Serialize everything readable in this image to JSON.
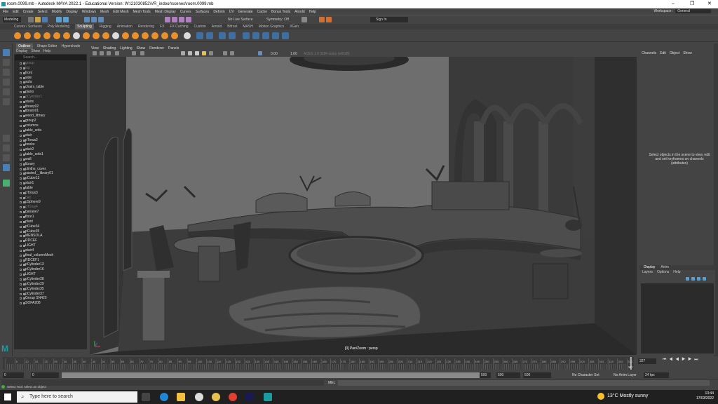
{
  "title": "room.0099.mb - Autodesk MAYA 2022.1 - Educational Version: W:\\21030852\\VR_indoor\\scenes\\room.0099.mb",
  "menu": [
    "File",
    "Edit",
    "Create",
    "Select",
    "Modify",
    "Display",
    "Windows",
    "Mesh",
    "Edit Mesh",
    "Mesh Tools",
    "Mesh Display",
    "Curves",
    "Surfaces",
    "Deform",
    "UV",
    "Generate",
    "Cache",
    "Bonus Tools",
    "Arnold",
    "Help"
  ],
  "workspace": {
    "label": "Workspace :",
    "value": "General"
  },
  "status": {
    "mode": "Modeling",
    "live": "No Live Surface",
    "symmetry": "Symmetry: Off",
    "signin": "Sign In"
  },
  "shelf_tabs": [
    "Curves / Surfaces",
    "Poly Modeling",
    "Sculpting",
    "Rigging",
    "Animation",
    "Rendering",
    "FX",
    "FX Caching",
    "Custom",
    "Arnold",
    "Bifrost",
    "MASH",
    "Motion Graphics",
    "XGen"
  ],
  "shelf_active": "Sculpting",
  "outliner": {
    "tabs": [
      "Outliner",
      "Shape Editor",
      "Hypershade"
    ],
    "menu": [
      "Display",
      "Show",
      "Help"
    ],
    "search": "Search...",
    "items": [
      {
        "n": "group",
        "d": true
      },
      {
        "n": "top",
        "d": true
      },
      {
        "n": "front",
        "d": false
      },
      {
        "n": "side",
        "d": false
      },
      {
        "n": "sofa",
        "d": false
      },
      {
        "n": "chairs_table",
        "d": false
      },
      {
        "n": "piano",
        "d": false
      },
      {
        "n": "pCylinder1",
        "d": true
      },
      {
        "n": "stairs",
        "d": false
      },
      {
        "n": "library02",
        "d": false
      },
      {
        "n": "library01",
        "d": false
      },
      {
        "n": "wood_library",
        "d": false
      },
      {
        "n": "group2",
        "d": false
      },
      {
        "n": "columns",
        "d": false
      },
      {
        "n": "table_sofa",
        "d": false
      },
      {
        "n": "stair",
        "d": false
      },
      {
        "n": "pTorus2",
        "d": false
      },
      {
        "n": "books",
        "d": false
      },
      {
        "n": "stair2",
        "d": false
      },
      {
        "n": "table_sofa1",
        "d": false
      },
      {
        "n": "wall",
        "d": false
      },
      {
        "n": "library",
        "d": false
      },
      {
        "n": "plinths_cover",
        "d": false
      },
      {
        "n": "pasted__library01",
        "d": false
      },
      {
        "n": "pCube13",
        "d": false
      },
      {
        "n": "stair1",
        "d": false
      },
      {
        "n": "table",
        "d": false
      },
      {
        "n": "pTorus3",
        "d": false
      },
      {
        "n": "ball",
        "d": true
      },
      {
        "n": "pSphere9",
        "d": false
      },
      {
        "n": "pTorus4",
        "d": true
      },
      {
        "n": "banane7",
        "d": false
      },
      {
        "n": "floor1",
        "d": false
      },
      {
        "n": "plant",
        "d": false
      },
      {
        "n": "pCube34",
        "d": false
      },
      {
        "n": "pCube35",
        "d": false
      },
      {
        "n": "MENSOLA",
        "d": false
      },
      {
        "n": "RDCEF",
        "d": false
      },
      {
        "n": "LIGHT",
        "d": false
      },
      {
        "n": "stair4",
        "d": false
      },
      {
        "n": "final_columnMesh",
        "d": false
      },
      {
        "n": "RDCEF1",
        "d": false
      },
      {
        "n": "pCylinder13",
        "d": false
      },
      {
        "n": "pCylinder16",
        "d": false
      },
      {
        "n": "LIGHT",
        "d": false
      },
      {
        "n": "pCylinder28",
        "d": false
      },
      {
        "n": "pCylinder29",
        "d": false
      },
      {
        "n": "pCylinder35",
        "d": false
      },
      {
        "n": "pCylinder37",
        "d": false
      },
      {
        "n": "Group SN420",
        "d": false
      },
      {
        "n": "SOFA208",
        "d": false
      }
    ]
  },
  "viewport": {
    "menu": [
      "View",
      "Shading",
      "Lighting",
      "Show",
      "Renderer",
      "Panels"
    ],
    "exposure": "0.00",
    "gamma": "1.00",
    "colorspace": "ACES 1.0 SDR-video (sRGB)",
    "camera": "[0] Pan/Zoom : persp"
  },
  "channel_box": {
    "menu": [
      "Channels",
      "Edit",
      "Object",
      "Show"
    ],
    "message": "Select objects in the scene to view, edit and set keyframes on channels (attributes)"
  },
  "layers": {
    "tabs": [
      "Display",
      "Anim"
    ],
    "menu": [
      "Layers",
      "Options",
      "Help"
    ]
  },
  "timeline": {
    "ticks": [
      "5",
      "10",
      "15",
      "20",
      "25",
      "30",
      "35",
      "40",
      "45",
      "50",
      "55",
      "60",
      "65",
      "70",
      "75",
      "80",
      "85",
      "90",
      "95",
      "100",
      "105",
      "110",
      "115",
      "120",
      "125",
      "130",
      "135",
      "140",
      "145",
      "150",
      "155",
      "160",
      "165",
      "170",
      "175",
      "180",
      "185",
      "190",
      "195",
      "200",
      "205",
      "210",
      "215",
      "220",
      "225",
      "230",
      "235",
      "240",
      "245",
      "250",
      "255",
      "260",
      "265",
      "270",
      "275",
      "280",
      "285",
      "290",
      "295",
      "300",
      "305",
      "310",
      "315",
      "320",
      "325"
    ],
    "current": "327",
    "current_box": "327"
  },
  "range": {
    "start": "0",
    "start2": "0",
    "end": "500",
    "end2": "500",
    "end3": "500",
    "char_set": "No Character Set",
    "anim_layer": "No Anim Layer",
    "fps": "24 fps"
  },
  "cmd": {
    "label": "MEL"
  },
  "help": "Select Tool: select an object",
  "taskbar": {
    "search": "Type here to search",
    "weather": "13°C  Mostly sunny",
    "time": "13:44",
    "date": "17/03/2022"
  },
  "colors": {
    "maya_bg": "#444444",
    "panel_dark": "#2b2b2b",
    "shelf_orange": "#e9902c",
    "viewport": "#6d6d6d"
  }
}
